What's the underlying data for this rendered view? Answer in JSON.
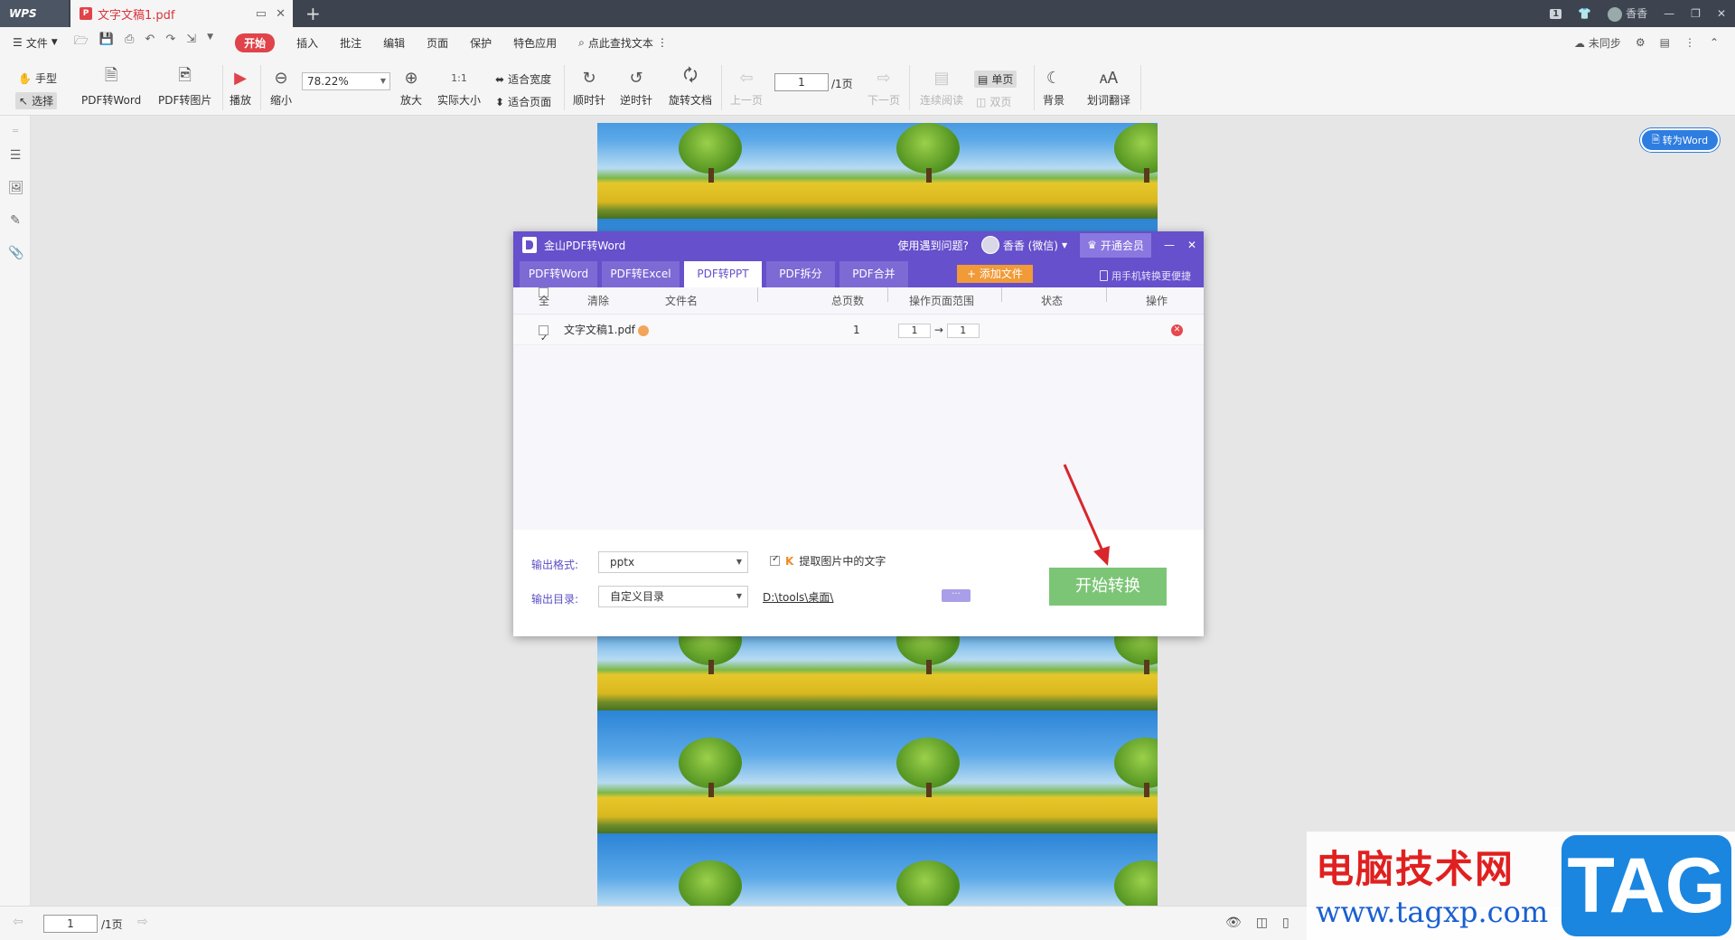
{
  "titlebar": {
    "app_name": "WPS",
    "doc_tab": "文字文稿1.pdf",
    "user": "香香",
    "page_badge": "1"
  },
  "menubar": {
    "file": "文件",
    "start": "开始",
    "items": [
      "插入",
      "批注",
      "编辑",
      "页面",
      "保护",
      "特色应用"
    ],
    "search": "点此查找文本",
    "sync": "未同步"
  },
  "ribbon": {
    "hand": "手型",
    "select": "选择",
    "pdf_to_word": "PDF转Word",
    "pdf_to_image": "PDF转图片",
    "play": "播放",
    "zoom_out": "缩小",
    "zoom_value": "78.22%",
    "zoom_in": "放大",
    "actual_size": "实际大小",
    "fit_width": "适合宽度",
    "fit_page": "适合页面",
    "clockwise": "顺时针",
    "counterclockwise": "逆时针",
    "rotate_doc": "旋转文档",
    "prev_page": "上一页",
    "page_value": "1",
    "page_total": "/1页",
    "next_page": "下一页",
    "continuous": "连续阅读",
    "single": "单页",
    "double": "双页",
    "background": "背景",
    "translate": "划词翻译"
  },
  "to_word_button": "转为Word",
  "dialog": {
    "title": "金山PDF转Word",
    "help": "使用遇到问题?",
    "user": "香香 (微信)",
    "vip": "开通会员",
    "tabs": [
      "PDF转Word",
      "PDF转Excel",
      "PDF转PPT",
      "PDF拆分",
      "PDF合并"
    ],
    "active_tab": "PDF转PPT",
    "add_file": "添加文件",
    "mobile": "用手机转换更便捷",
    "columns": {
      "select_all": "全选",
      "clear": "清除",
      "filename": "文件名",
      "pages": "总页数",
      "range": "操作页面范围",
      "status": "状态",
      "action": "操作"
    },
    "rows": [
      {
        "name": "文字文稿1.pdf",
        "pages": "1",
        "from": "1",
        "to": "1"
      }
    ],
    "output_format_label": "输出格式:",
    "output_format": "pptx",
    "extract_text": "提取图片中的文字",
    "output_dir_label": "输出目录:",
    "output_dir": "自定义目录",
    "path": "D:\\tools\\桌面\\",
    "more": "···",
    "convert": "开始转换"
  },
  "statusbar": {
    "page_value": "1",
    "page_total": "/1页"
  },
  "watermark": {
    "cn": "电脑技术网",
    "url": "www.tagxp.com",
    "tag": "TAG"
  },
  "colors": {
    "dialog_purple": "#6650cb",
    "convert_green": "#7cc576",
    "start_red": "#e0434a",
    "add_orange": "#f19a38"
  }
}
